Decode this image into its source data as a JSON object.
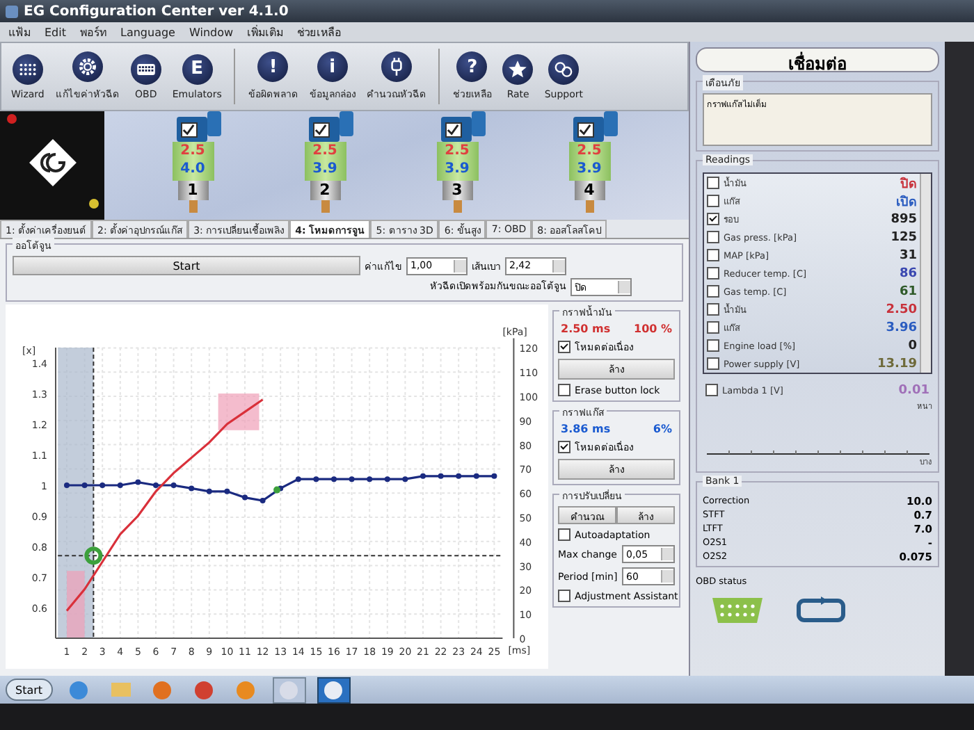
{
  "window": {
    "title": "EG Configuration Center ver 4.1.0"
  },
  "menu": [
    "แฟ้ม",
    "Edit",
    "พอร์ท",
    "Language",
    "Window",
    "เพิ่มเติม",
    "ช่วยเหลือ"
  ],
  "toolbar": [
    [
      {
        "label": "Wizard",
        "kind": "grid"
      },
      {
        "label": "แก้ไขค่าหัวฉีด",
        "kind": "gear"
      },
      {
        "label": "OBD",
        "kind": "keyboard"
      },
      {
        "label": "Emulators",
        "kind": "letter",
        "glyph": "E"
      }
    ],
    [
      {
        "label": "ข้อผิดพลาด",
        "kind": "letter",
        "glyph": "!"
      },
      {
        "label": "ข้อมูลกล่อง",
        "kind": "letter",
        "glyph": "i"
      },
      {
        "label": "คำนวณหัวฉีด",
        "kind": "plug"
      }
    ],
    [
      {
        "label": "ช่วยเหลือ",
        "kind": "letter",
        "glyph": "?"
      },
      {
        "label": "Rate",
        "kind": "star"
      },
      {
        "label": "Support",
        "kind": "support"
      }
    ]
  ],
  "injectors": [
    {
      "checked": true,
      "petrol": "2.5",
      "gas": "4.0",
      "number": "1"
    },
    {
      "checked": true,
      "petrol": "2.5",
      "gas": "3.9",
      "number": "2"
    },
    {
      "checked": true,
      "petrol": "2.5",
      "gas": "3.9",
      "number": "3"
    },
    {
      "checked": true,
      "petrol": "2.5",
      "gas": "3.9",
      "number": "4"
    }
  ],
  "tabs": [
    {
      "label": "1: ตั้งค่าเครื่องยนต์",
      "selected": false
    },
    {
      "label": "2: ตั้งค่าอุปกรณ์แก๊ส",
      "selected": false
    },
    {
      "label": "3: การเปลี่ยนเชื้อเพลิง",
      "selected": false
    },
    {
      "label": "4: โหมดการจูน",
      "selected": true
    },
    {
      "label": "5: ตาราง 3D",
      "selected": false
    },
    {
      "label": "6: ขั้นสูง",
      "selected": false
    },
    {
      "label": "7: OBD",
      "selected": false
    },
    {
      "label": "8: ออสโลสโคป",
      "selected": false
    }
  ],
  "autotune": {
    "title": "ออโต้จูน",
    "start": "Start",
    "correction_label": "ค่าแก้ไข",
    "correction": "1,00",
    "line_label": "เส้นเบา",
    "line": "2,42",
    "simultaneous_label": "หัวฉีดเปิดพร้อมกันขณะออโต้จูน",
    "simultaneous": "ปิด"
  },
  "chart": {
    "right_axis": {
      "label": "[kPa]",
      "ticks": [
        "120",
        "110",
        "100",
        "90",
        "80",
        "70",
        "60",
        "50",
        "40",
        "30",
        "20",
        "10",
        "0"
      ]
    },
    "chart_data": {
      "type": "line",
      "ylabel": "[x]",
      "xlabel": "[ms]",
      "x": [
        1,
        2,
        3,
        4,
        5,
        6,
        7,
        8,
        9,
        10,
        11,
        12,
        13,
        14,
        15,
        16,
        17,
        18,
        19,
        20,
        21,
        22,
        23,
        24,
        25
      ],
      "xticks": [
        1,
        2,
        3,
        4,
        5,
        6,
        7,
        8,
        9,
        10,
        11,
        12,
        13,
        14,
        15,
        16,
        17,
        18,
        19,
        20,
        21,
        22,
        23,
        24,
        25
      ],
      "yticks": [
        0.6,
        0.7,
        0.8,
        0.9,
        1.0,
        1.1,
        1.2,
        1.3,
        1.4
      ],
      "ylim": [
        0.5,
        1.45
      ],
      "xlim": [
        0.5,
        25.5
      ],
      "grid": true,
      "bands": [
        {
          "axis": "x",
          "from": 0.5,
          "to": 2.5,
          "color": "#aab8cc"
        },
        {
          "axis": "x",
          "from": 1,
          "to": 2,
          "color": "#f0a0b8"
        },
        {
          "axis": "x",
          "from": 9.5,
          "to": 11.8,
          "color": "#f0a0b8"
        }
      ],
      "ref_lines": [
        {
          "axis": "x",
          "value": 2.5
        },
        {
          "axis": "y",
          "value": 0.77
        }
      ],
      "series": [
        {
          "color": "#1a2a80",
          "marker": "o",
          "values": [
            1.0,
            1.0,
            1.0,
            1.0,
            1.01,
            1.0,
            1.0,
            0.99,
            0.98,
            0.98,
            0.96,
            0.95,
            0.99,
            1.02,
            1.02,
            1.02,
            1.02,
            1.02,
            1.02,
            1.02,
            1.03,
            1.03,
            1.03,
            1.03,
            1.03
          ]
        },
        {
          "color": "#d9303a",
          "values": [
            0.59,
            0.66,
            0.75,
            0.84,
            0.9,
            0.98,
            1.04,
            1.09,
            1.14,
            1.2,
            1.24,
            1.28,
            null,
            null,
            null,
            null,
            null,
            null,
            null,
            null,
            null,
            null,
            null,
            null,
            null
          ]
        }
      ]
    }
  },
  "petrol_graph": {
    "title": "กราฟน้ำมัน",
    "time": "2.50 ms",
    "percent": "100 %",
    "continuous": {
      "label": "โหมดต่อเนื่อง",
      "checked": true
    },
    "clear": "ล้าง",
    "erase_lock": {
      "label": "Erase button lock",
      "checked": false
    }
  },
  "gas_graph": {
    "title": "กราฟแก๊ส",
    "time": "3.86 ms",
    "percent": "6%",
    "continuous": {
      "label": "โหมดต่อเนื่อง",
      "checked": true
    },
    "clear": "ล้าง"
  },
  "adjust": {
    "title": "การปรับเปลี่ยน",
    "calculate": "คำนวณ",
    "clear": "ล้าง",
    "autoadaptation": {
      "label": "Autoadaptation",
      "checked": false
    },
    "max_change_label": "Max change",
    "max_change": "0,05",
    "period_label": "Period [min]",
    "period": "60",
    "assistant": {
      "label": "Adjustment Assistant",
      "checked": false
    }
  },
  "connect": "เชื่อมต่อ",
  "alerts": {
    "title": "เตือนภัย",
    "message": "กราฟแก๊สไม่เต็ม"
  },
  "readings": {
    "title": "Readings",
    "items": [
      {
        "label": "น้ำมัน",
        "checked": false,
        "value": "ปิด",
        "color": "#c8323c"
      },
      {
        "label": "แก๊ส",
        "checked": false,
        "value": "เปิด",
        "color": "#2a5cc0"
      },
      {
        "label": "รอบ",
        "checked": true,
        "value": "895",
        "color": "#222222"
      },
      {
        "label": "Gas press. [kPa]",
        "checked": false,
        "value": "125",
        "color": "#222222"
      },
      {
        "label": "MAP [kPa]",
        "checked": false,
        "value": "31",
        "color": "#222222"
      },
      {
        "label": "Reducer temp. [C]",
        "checked": false,
        "value": "86",
        "color": "#3a48b0"
      },
      {
        "label": "Gas temp. [C]",
        "checked": false,
        "value": "61",
        "color": "#2f5a2a"
      },
      {
        "label": "น้ำมัน",
        "checked": false,
        "value": "2.50",
        "color": "#c8323c"
      },
      {
        "label": "แก๊ส",
        "checked": false,
        "value": "3.96",
        "color": "#2a5cc0"
      },
      {
        "label": "Engine load [%]",
        "checked": false,
        "value": "0",
        "color": "#222222"
      },
      {
        "label": "Power supply [V]",
        "checked": false,
        "value": "13.19",
        "color": "#6e6a3a"
      }
    ],
    "lambda": {
      "label": "Lambda 1 [V]",
      "checked": false,
      "value": "0.01",
      "color": "#a070b8"
    },
    "rich_label": "หนา",
    "lean_label": "บาง"
  },
  "bank": {
    "title": "Bank 1",
    "rows": [
      {
        "label": "Correction",
        "value": "10.0"
      },
      {
        "label": "STFT",
        "value": "0.7"
      },
      {
        "label": "LTFT",
        "value": "7.0"
      },
      {
        "label": "O2S1",
        "value": "-"
      },
      {
        "label": "O2S2",
        "value": "0.075"
      }
    ]
  },
  "obd_status": "OBD status",
  "taskbar": {
    "start": "Start"
  }
}
